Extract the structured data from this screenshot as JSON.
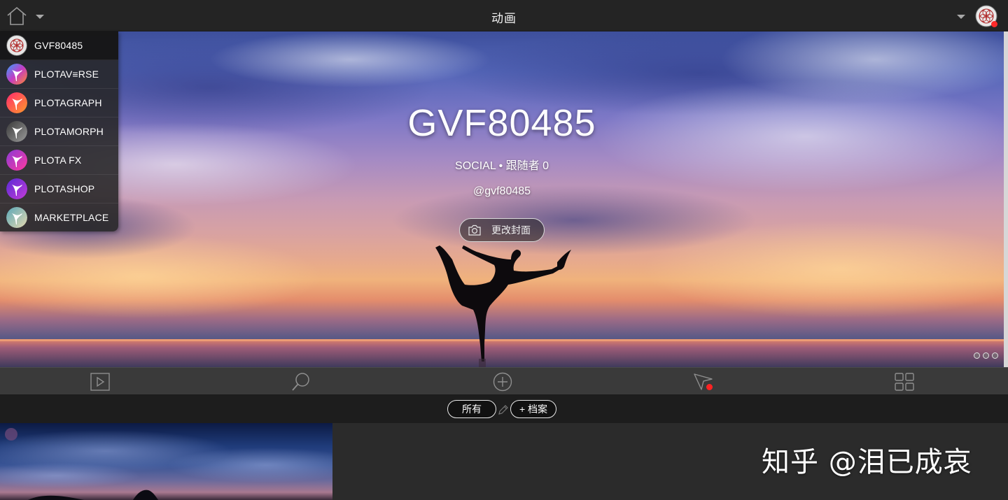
{
  "topbar": {
    "title": "动画"
  },
  "profile": {
    "name": "GVF80485",
    "subtitle": "SOCIAL • 跟随者 0",
    "handle": "@gvf80485",
    "change_cover_label": "更改封面"
  },
  "menu": {
    "items": [
      {
        "label": "GVF80485",
        "icon": "mandala-logo-icon"
      },
      {
        "label": "PLOTAV≡RSE",
        "icon": "plotaverse-dancer-icon"
      },
      {
        "label": "PLOTAGRAPH",
        "icon": "plotagraph-dancer-icon"
      },
      {
        "label": "PLOTAMORPH",
        "icon": "plotamorph-dancer-icon"
      },
      {
        "label": "PLOTA FX",
        "icon": "plota-fx-dancer-icon"
      },
      {
        "label": "PLOTASHOP",
        "icon": "plotashop-dancer-icon"
      },
      {
        "label": "MARKETPLACE",
        "icon": "marketplace-dancer-icon"
      }
    ]
  },
  "tabs": {
    "icons": [
      "play-icon",
      "search-icon",
      "add-circle-icon",
      "send-icon",
      "grid-icon"
    ]
  },
  "filter": {
    "all_label": "所有",
    "archive_label": "+ 档案"
  },
  "watermark": {
    "text": "知乎 @泪已成哀"
  },
  "colors": {
    "topbar_bg": "#242424",
    "tabbar_bg": "#3a3a3a",
    "filterbar_bg": "#1d1d1d",
    "notification": "#ff2a2a"
  }
}
